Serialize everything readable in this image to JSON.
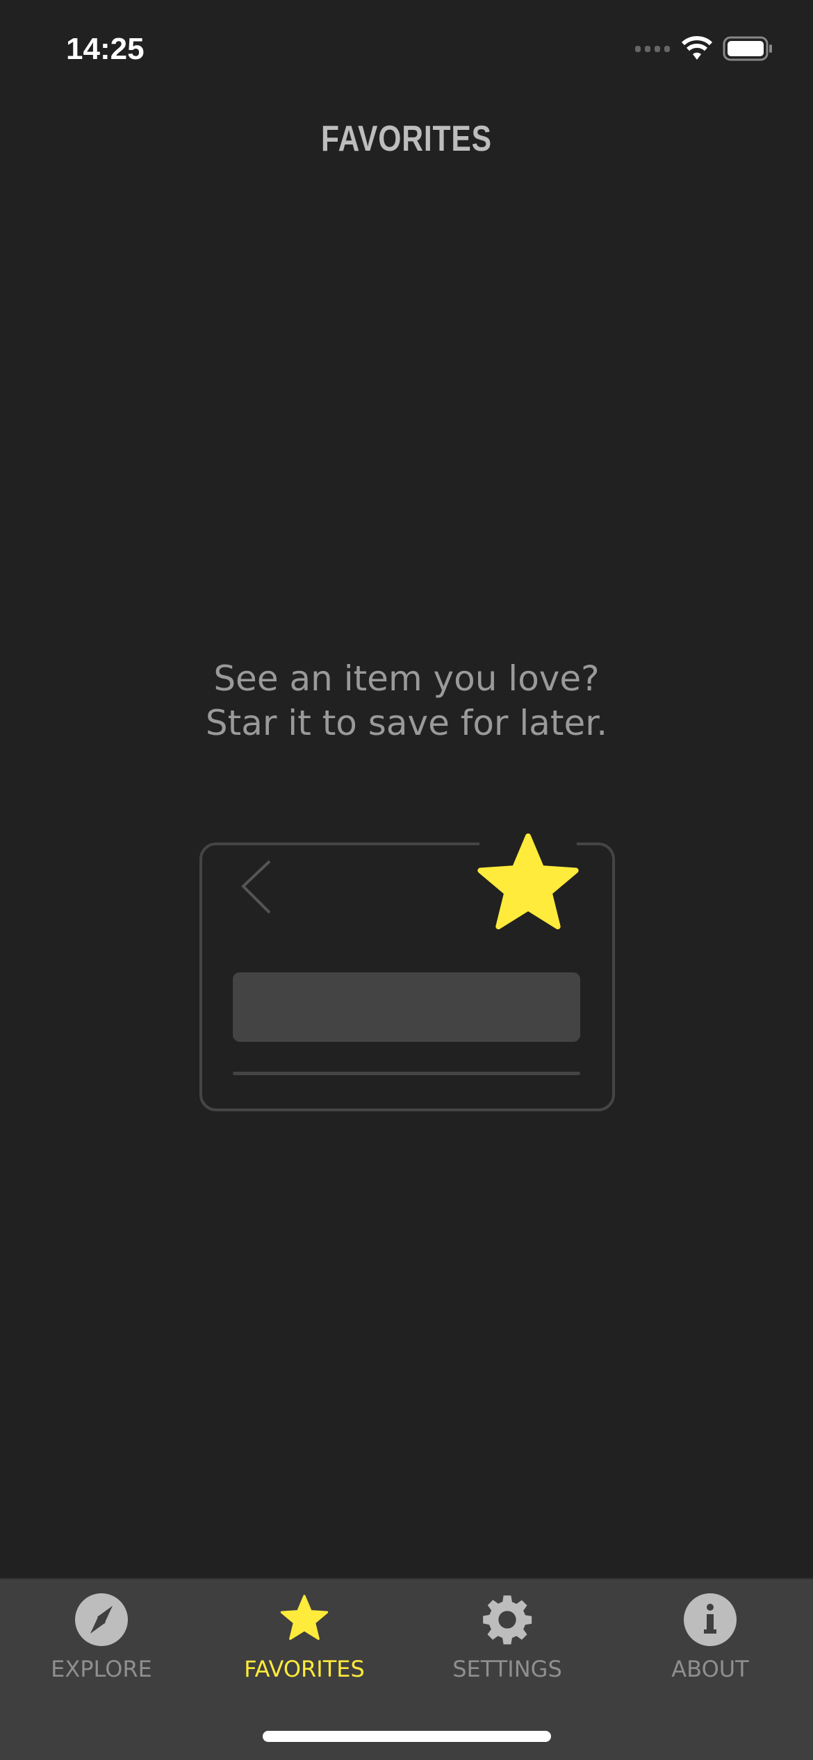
{
  "status_bar": {
    "time": "14:25",
    "icons": [
      "signal-icon",
      "wifi-icon",
      "battery-icon"
    ]
  },
  "header": {
    "title": "FAVORITES"
  },
  "empty_state": {
    "line1": "See an item you love?",
    "line2": "Star it to save for later.",
    "illustration_icons": [
      "chevron-left-icon",
      "star-icon"
    ]
  },
  "colors": {
    "background": "#212121",
    "accent": "#ffeb3b",
    "tabbar": "#3f3f3f",
    "muted": "#8f8f8f"
  },
  "tabs": [
    {
      "label": "EXPLORE",
      "icon": "compass-icon",
      "active": false
    },
    {
      "label": "FAVORITES",
      "icon": "star-icon",
      "active": true
    },
    {
      "label": "SETTINGS",
      "icon": "gear-icon",
      "active": false
    },
    {
      "label": "ABOUT",
      "icon": "info-icon",
      "active": false
    }
  ]
}
